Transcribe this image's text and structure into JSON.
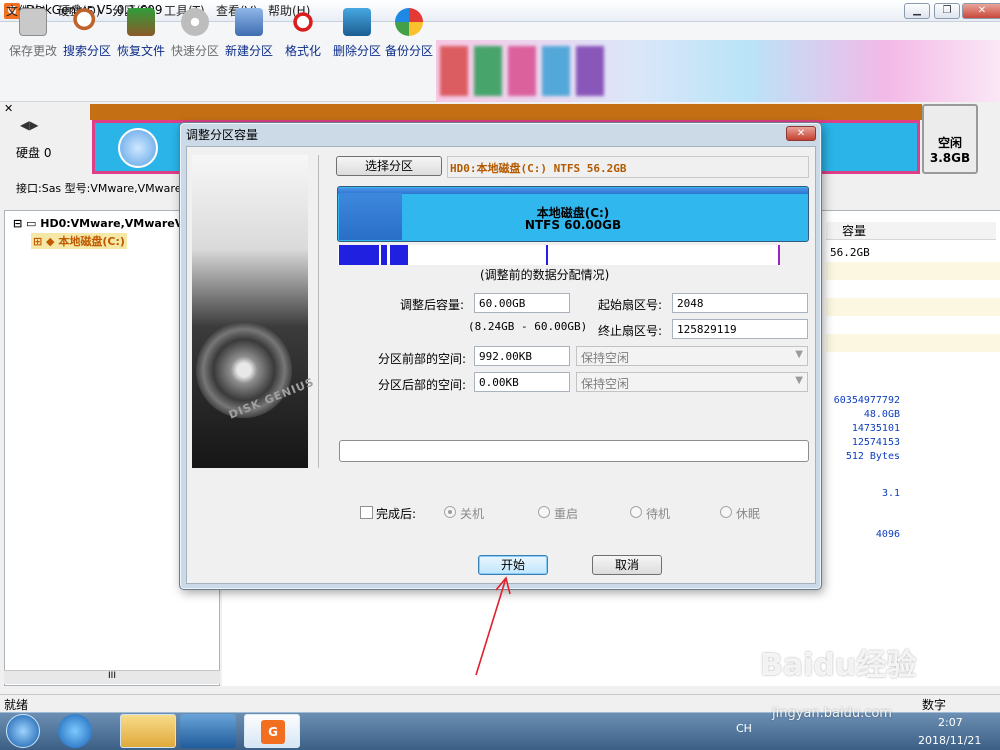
{
  "window": {
    "app_icon": "G",
    "title": "DiskGenius V5.0.1.609",
    "controls": [
      "minimize-icon",
      "restore-icon",
      "close-icon"
    ]
  },
  "menu": [
    {
      "label": "文件(F)"
    },
    {
      "label": "硬盘(D)"
    },
    {
      "label": "分区(P)"
    },
    {
      "label": "工具(T)"
    },
    {
      "label": "查看(V)"
    },
    {
      "label": "帮助(H)"
    }
  ],
  "toolbar": [
    {
      "label": "保存更改",
      "icon": "save-icon",
      "enabled": false
    },
    {
      "label": "搜索分区",
      "icon": "magnifier-icon",
      "enabled": true
    },
    {
      "label": "恢复文件",
      "icon": "recover-icon",
      "enabled": true
    },
    {
      "label": "快速分区",
      "icon": "quick-partition-icon",
      "enabled": false
    },
    {
      "label": "新建分区",
      "icon": "new-partition-icon",
      "enabled": true
    },
    {
      "label": "格式化",
      "icon": "format-icon",
      "enabled": true
    },
    {
      "label": "删除分区",
      "icon": "delete-icon",
      "enabled": true
    },
    {
      "label": "备份分区",
      "icon": "backup-icon",
      "enabled": true
    }
  ],
  "diskbar": {
    "disk_label": "硬盘 0",
    "interface_label": "接口:Sas  型号:VMware,VMware",
    "free_label": "空闲",
    "free_size": "3.8GB"
  },
  "tree": {
    "root": "HD0:VMware,VMwareVi",
    "child": "本地磁盘(C:)",
    "scroll_marker": "III"
  },
  "right_panel": {
    "capacity_header": "容量",
    "capacity_value": "56.2GB",
    "values": [
      "60354977792",
      "48.0GB",
      "14735101",
      "12574153",
      "512 Bytes",
      "3.1",
      "4096"
    ]
  },
  "dialog": {
    "title": "调整分区容量",
    "close_icon": "close-icon",
    "hdd_brand": "DISK GENIUS",
    "select_button": "选择分区",
    "selected_partition": "HD0:本地磁盘(C:) NTFS 56.2GB",
    "partition_name": "本地磁盘(C:)",
    "partition_fs_size": "NTFS 60.00GB",
    "distribution_caption": "(调整前的数据分配情况)",
    "fields": {
      "new_size_label": "调整后容量:",
      "new_size_value": "60.00GB",
      "range_text": "(8.24GB - 60.00GB)",
      "start_sector_label": "起始扇区号:",
      "start_sector_value": "2048",
      "end_sector_label": "终止扇区号:",
      "end_sector_value": "125829119",
      "space_before_label": "分区前部的空间:",
      "space_before_value": "992.00KB",
      "space_before_option": "保持空闲",
      "space_after_label": "分区后部的空间:",
      "space_after_value": "0.00KB",
      "space_after_option": "保持空闲"
    },
    "progress": 0,
    "after_done_label": "完成后:",
    "after_done_checked": false,
    "options": [
      {
        "label": "关机",
        "checked": true
      },
      {
        "label": "重启",
        "checked": false
      },
      {
        "label": "待机",
        "checked": false
      },
      {
        "label": "休眠",
        "checked": false
      }
    ],
    "start_button": "开始",
    "cancel_button": "取消"
  },
  "statusbar": {
    "status": "就绪",
    "numlock": "数字"
  },
  "taskbar": {
    "lang": "CH",
    "time": "2:07",
    "date": "2018/11/21"
  },
  "watermark": {
    "main": "Baidu经验",
    "sub": "jingyan.baidu.com"
  },
  "colors": {
    "partition_blue": "#2fb7ee",
    "disk_map_border": "#de3f86",
    "tree_selected": "#c05a00",
    "value_blue": "#0c3ebd",
    "annotation_arrow": "#e0202a"
  }
}
